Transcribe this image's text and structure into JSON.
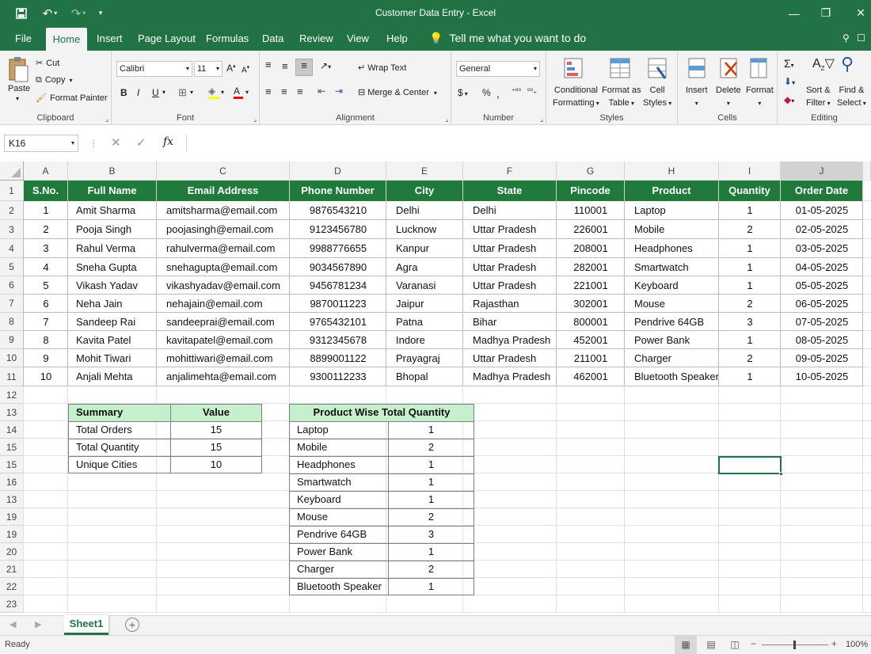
{
  "window": {
    "title": "Customer Data Entry  -  Excel"
  },
  "menu": [
    "File",
    "Home",
    "Insert",
    "Page Layout",
    "Formulas",
    "Data",
    "Review",
    "View",
    "Help"
  ],
  "tell_me": "Tell me what you want to do",
  "ribbon": {
    "clipboard": {
      "paste": "Paste",
      "cut": "Cut",
      "copy": "Copy",
      "format_painter": "Format Painter",
      "label": "Clipboard"
    },
    "font": {
      "name": "Calibri",
      "size": "11",
      "label": "Font"
    },
    "alignment": {
      "wrap": "Wrap Text",
      "merge": "Merge & Center",
      "label": "Alignment"
    },
    "number": {
      "format": "General",
      "label": "Number"
    },
    "styles": {
      "conditional": [
        "Conditional",
        "Formatting"
      ],
      "format_table": [
        "Format as",
        "Table"
      ],
      "cell_styles": [
        "Cell",
        "Styles"
      ],
      "label": "Styles"
    },
    "cells": {
      "insert": "Insert",
      "delete": "Delete",
      "format": "Format",
      "label": "Cells"
    },
    "editing": {
      "sort": [
        "Sort &",
        "Filter"
      ],
      "find": [
        "Find &",
        "Select"
      ],
      "label": "Editing"
    }
  },
  "formula_bar": {
    "name_box": "K16",
    "fx": "fx"
  },
  "columns": [
    "A",
    "B",
    "C",
    "D",
    "E",
    "F",
    "G",
    "H",
    "I",
    "J"
  ],
  "rows": [
    "1",
    "2",
    "3",
    "4",
    "5",
    "6",
    "7",
    "8",
    "9",
    "10",
    "11",
    "12",
    "13",
    "14",
    "15",
    "15",
    "16",
    "13",
    "19",
    "19",
    "20",
    "21",
    "22",
    "23"
  ],
  "table": {
    "headers": [
      "S.No.",
      "Full Name",
      "Email Address",
      "Phone Number",
      "City",
      "State",
      "Pincode",
      "Product",
      "Quantity",
      "Order Date"
    ],
    "rows": [
      [
        "1",
        "Amit Sharma",
        "amitsharma@email.com",
        "9876543210",
        "Delhi",
        "Delhi",
        "110001",
        "Laptop",
        "1",
        "01-05-2025"
      ],
      [
        "2",
        "Pooja Singh",
        "poojasingh@email.com",
        "9123456780",
        "Lucknow",
        "Uttar Pradesh",
        "226001",
        "Mobile",
        "2",
        "02-05-2025"
      ],
      [
        "3",
        "Rahul Verma",
        "rahulverma@email.com",
        "9988776655",
        "Kanpur",
        "Uttar Pradesh",
        "208001",
        "Headphones",
        "1",
        "03-05-2025"
      ],
      [
        "4",
        "Sneha Gupta",
        "snehagupta@email.com",
        "9034567890",
        "Agra",
        "Uttar Pradesh",
        "282001",
        "Smartwatch",
        "1",
        "04-05-2025"
      ],
      [
        "5",
        "Vikash Yadav",
        "vikashyadav@email.com",
        "9456781234",
        "Varanasi",
        "Uttar Pradesh",
        "221001",
        "Keyboard",
        "1",
        "05-05-2025"
      ],
      [
        "6",
        "Neha Jain",
        "nehajain@email.com",
        "9870011223",
        "Jaipur",
        "Rajasthan",
        "302001",
        "Mouse",
        "2",
        "06-05-2025"
      ],
      [
        "7",
        "Sandeep Rai",
        "sandeeprai@email.com",
        "9765432101",
        "Patna",
        "Bihar",
        "800001",
        "Pendrive 64GB",
        "3",
        "07-05-2025"
      ],
      [
        "8",
        "Kavita Patel",
        "kavitapatel@email.com",
        "9312345678",
        "Indore",
        "Madhya Pradesh",
        "452001",
        "Power Bank",
        "1",
        "08-05-2025"
      ],
      [
        "9",
        "Mohit Tiwari",
        "mohittiwari@email.com",
        "8899001122",
        "Prayagraj",
        "Uttar Pradesh",
        "211001",
        "Charger",
        "2",
        "09-05-2025"
      ],
      [
        "10",
        "Anjali Mehta",
        "anjalimehta@email.com",
        "9300112233",
        "Bhopal",
        "Madhya Pradesh",
        "462001",
        "Bluetooth Speaker",
        "1",
        "10-05-2025"
      ]
    ]
  },
  "summary": {
    "headers": [
      "Summary",
      "Value"
    ],
    "rows": [
      [
        "Total Orders",
        "15"
      ],
      [
        "Total Quantity",
        "15"
      ],
      [
        "Unique Cities",
        "10"
      ]
    ]
  },
  "product_summary": {
    "header": "Product Wise Total Quantity",
    "rows": [
      [
        "Laptop",
        "1"
      ],
      [
        "Mobile",
        "2"
      ],
      [
        "Headphones",
        "1"
      ],
      [
        "Smartwatch",
        "1"
      ],
      [
        "Keyboard",
        "1"
      ],
      [
        "Mouse",
        "2"
      ],
      [
        "Pendrive 64GB",
        "3"
      ],
      [
        "Power Bank",
        "1"
      ],
      [
        "Charger",
        "2"
      ],
      [
        "Bluetooth Speaker",
        "1"
      ]
    ]
  },
  "sheet_tab": "Sheet1",
  "status": {
    "ready": "Ready",
    "zoom": "100%"
  },
  "colors": {
    "excel_green": "#217346",
    "header_green": "#1f7a3b",
    "summary_header": "#c6efce"
  }
}
